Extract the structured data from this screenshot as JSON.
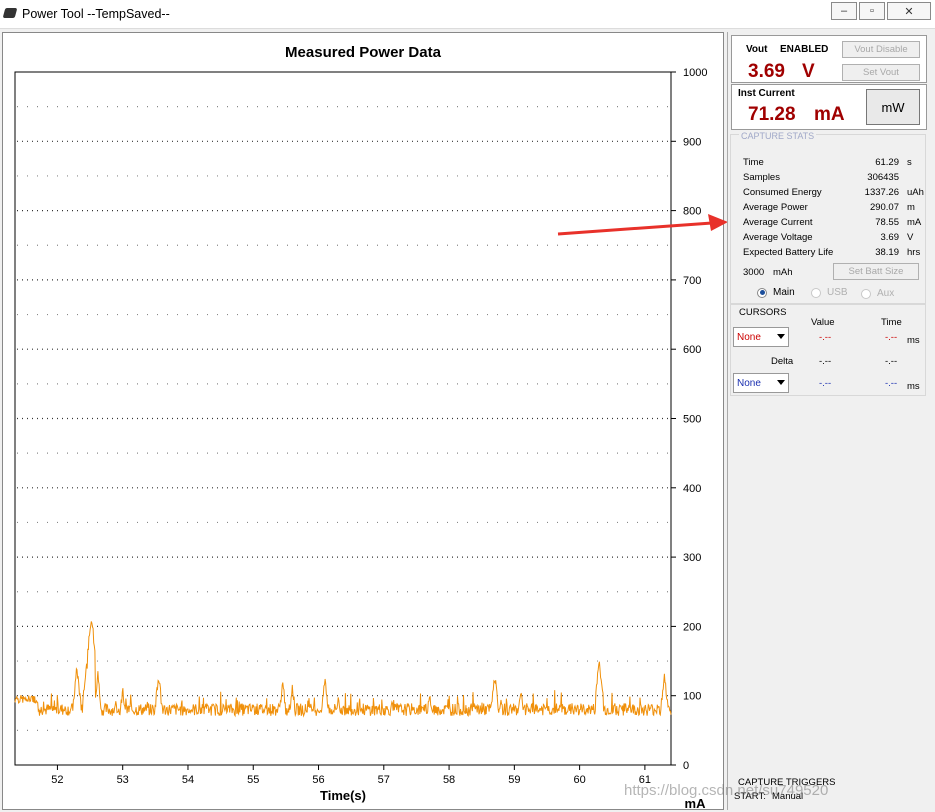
{
  "window": {
    "title": "Power Tool --TempSaved--",
    "min": "–",
    "max": "▫",
    "close": "✕"
  },
  "chart_data": {
    "type": "line",
    "title": "Measured Power Data",
    "xlabel": "Time(s)",
    "ylabel": "mA",
    "xlim": [
      51.35,
      61.4
    ],
    "ylim": [
      0,
      1000
    ],
    "x_ticks": [
      "52",
      "53",
      "54",
      "55",
      "56",
      "57",
      "58",
      "59",
      "60",
      "61"
    ],
    "y_ticks": [
      "0",
      "100",
      "200",
      "300",
      "400",
      "500",
      "600",
      "700",
      "800",
      "900",
      "1000"
    ],
    "grid": true,
    "color": "#f0900a",
    "series": [
      {
        "baseline": 80,
        "spikes": [
          [
            51.6,
            100
          ],
          [
            52.3,
            140
          ],
          [
            52.45,
            150
          ],
          [
            52.52,
            215
          ],
          [
            52.62,
            130
          ],
          [
            53.0,
            110
          ],
          [
            53.55,
            130
          ],
          [
            55.45,
            120
          ],
          [
            55.6,
            115
          ],
          [
            56.1,
            125
          ],
          [
            56.3,
            100
          ],
          [
            57.7,
            105
          ],
          [
            58.7,
            130
          ],
          [
            59.1,
            110
          ],
          [
            60.3,
            150
          ],
          [
            61.3,
            130
          ]
        ]
      }
    ]
  },
  "vout": {
    "label": "Vout",
    "state": "ENABLED",
    "value": "3.69",
    "unit": "V",
    "disable_btn": "Vout Disable",
    "set_btn": "Set Vout"
  },
  "inst": {
    "label": "Inst Current",
    "value": "71.28",
    "unit": "mA",
    "mode_btn": "mW"
  },
  "stats": {
    "title": "CAPTURE STATS",
    "rows": [
      {
        "name": "Time",
        "value": "61.29",
        "unit": "s"
      },
      {
        "name": "Samples",
        "value": "306435",
        "unit": ""
      },
      {
        "name": "Consumed Energy",
        "value": "1337.26",
        "unit": "uAh"
      },
      {
        "name": "Average Power",
        "value": "290.07",
        "unit": "m"
      },
      {
        "name": "Average Current",
        "value": "78.55",
        "unit": "mA"
      },
      {
        "name": "Average Voltage",
        "value": "3.69",
        "unit": "V"
      },
      {
        "name": "Expected Battery Life",
        "value": "38.19",
        "unit": "hrs"
      }
    ],
    "batt_value": "3000",
    "batt_unit": "mAh",
    "batt_btn": "Set Batt Size",
    "channels": [
      "Main",
      "USB",
      "Aux"
    ]
  },
  "cursors": {
    "title": "CURSORS",
    "col_value": "Value",
    "col_time": "Time",
    "sel1": "None",
    "sel2": "None",
    "dash": "-.--",
    "unit": "ms",
    "delta": "Delta"
  },
  "triggers": {
    "title": "CAPTURE TRIGGERS",
    "start_label": "START:",
    "start_value": "Manual"
  },
  "watermark": "https://blog.csdn.net/su749520",
  "colors": {
    "red_value": "#a00000",
    "trace": "#f0900a",
    "arrow": "#e8312a"
  }
}
